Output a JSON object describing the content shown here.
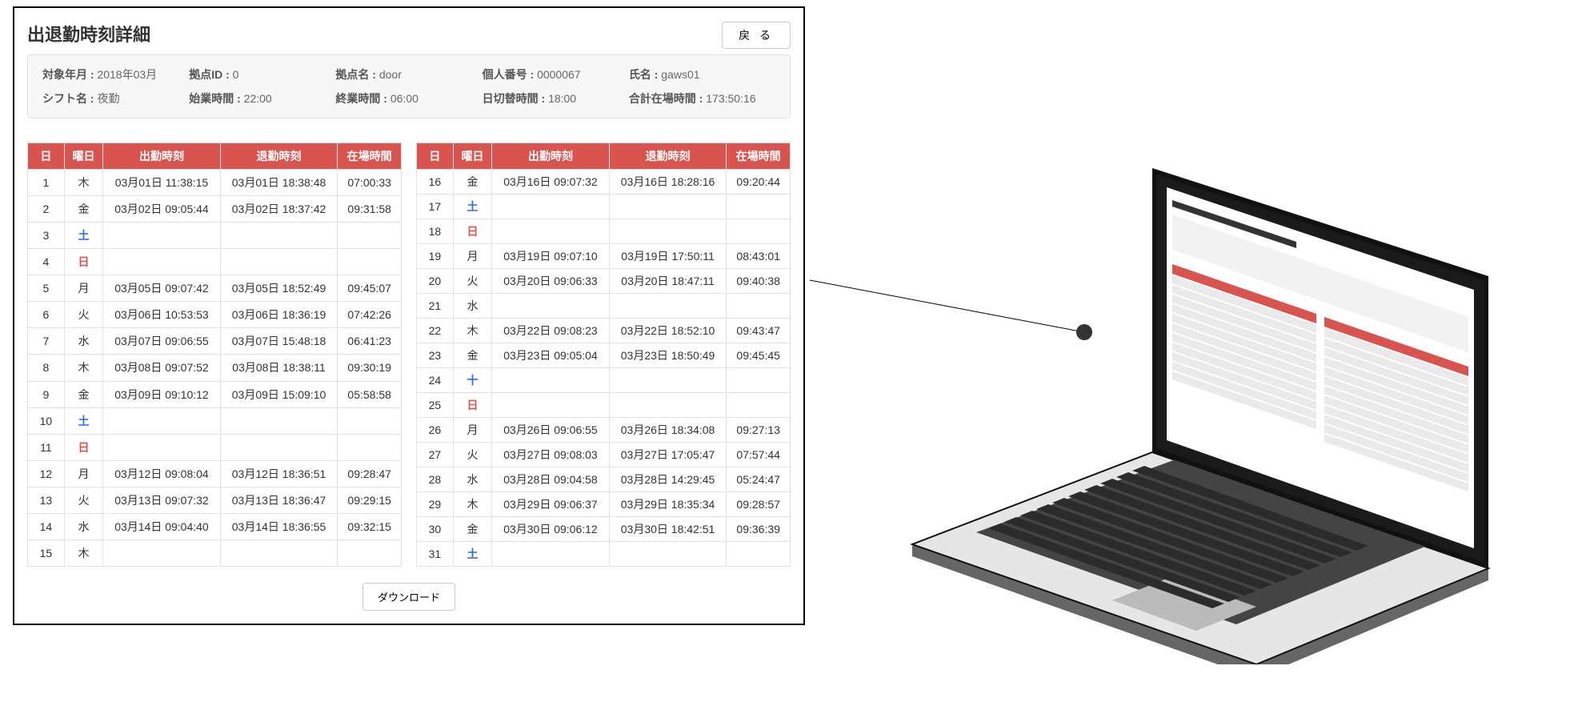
{
  "title": "出退勤時刻詳細",
  "buttons": {
    "back": "戻 る",
    "download": "ダウンロード"
  },
  "meta": {
    "row1": [
      {
        "label": "対象年月 :",
        "value": "2018年03月"
      },
      {
        "label": "拠点ID :",
        "value": "0"
      },
      {
        "label": "拠点名 :",
        "value": "door"
      },
      {
        "label": "個人番号 :",
        "value": "0000067"
      },
      {
        "label": "氏名 :",
        "value": "gaws01"
      }
    ],
    "row2": [
      {
        "label": "シフト名 :",
        "value": "夜勤"
      },
      {
        "label": "始業時間 :",
        "value": "22:00"
      },
      {
        "label": "終業時間 :",
        "value": "06:00"
      },
      {
        "label": "日切替時間 :",
        "value": "18:00"
      },
      {
        "label": "合計在場時間 :",
        "value": "173:50:16"
      }
    ]
  },
  "columns": {
    "day": "日",
    "dow": "曜日",
    "in": "出勤時刻",
    "out": "退勤時刻",
    "dur": "在場時間"
  },
  "rows": [
    {
      "d": "1",
      "w": "木",
      "wc": "",
      "in": "03月01日 11:38:15",
      "out": "03月01日 18:38:48",
      "dur": "07:00:33"
    },
    {
      "d": "2",
      "w": "金",
      "wc": "",
      "in": "03月02日 09:05:44",
      "out": "03月02日 18:37:42",
      "dur": "09:31:58"
    },
    {
      "d": "3",
      "w": "土",
      "wc": "sat",
      "in": "",
      "out": "",
      "dur": ""
    },
    {
      "d": "4",
      "w": "日",
      "wc": "sun",
      "in": "",
      "out": "",
      "dur": ""
    },
    {
      "d": "5",
      "w": "月",
      "wc": "",
      "in": "03月05日 09:07:42",
      "out": "03月05日 18:52:49",
      "dur": "09:45:07"
    },
    {
      "d": "6",
      "w": "火",
      "wc": "",
      "in": "03月06日 10:53:53",
      "out": "03月06日 18:36:19",
      "dur": "07:42:26"
    },
    {
      "d": "7",
      "w": "水",
      "wc": "",
      "in": "03月07日 09:06:55",
      "out": "03月07日 15:48:18",
      "dur": "06:41:23"
    },
    {
      "d": "8",
      "w": "木",
      "wc": "",
      "in": "03月08日 09:07:52",
      "out": "03月08日 18:38:11",
      "dur": "09:30:19"
    },
    {
      "d": "9",
      "w": "金",
      "wc": "",
      "in": "03月09日 09:10:12",
      "out": "03月09日 15:09:10",
      "dur": "05:58:58"
    },
    {
      "d": "10",
      "w": "土",
      "wc": "sat",
      "in": "",
      "out": "",
      "dur": ""
    },
    {
      "d": "11",
      "w": "日",
      "wc": "sun",
      "in": "",
      "out": "",
      "dur": ""
    },
    {
      "d": "12",
      "w": "月",
      "wc": "",
      "in": "03月12日 09:08:04",
      "out": "03月12日 18:36:51",
      "dur": "09:28:47"
    },
    {
      "d": "13",
      "w": "火",
      "wc": "",
      "in": "03月13日 09:07:32",
      "out": "03月13日 18:36:47",
      "dur": "09:29:15"
    },
    {
      "d": "14",
      "w": "水",
      "wc": "",
      "in": "03月14日 09:04:40",
      "out": "03月14日 18:36:55",
      "dur": "09:32:15"
    },
    {
      "d": "15",
      "w": "木",
      "wc": "",
      "in": "",
      "out": "",
      "dur": ""
    },
    {
      "d": "16",
      "w": "金",
      "wc": "",
      "in": "03月16日 09:07:32",
      "out": "03月16日 18:28:16",
      "dur": "09:20:44"
    },
    {
      "d": "17",
      "w": "土",
      "wc": "sat",
      "in": "",
      "out": "",
      "dur": ""
    },
    {
      "d": "18",
      "w": "日",
      "wc": "sun",
      "in": "",
      "out": "",
      "dur": ""
    },
    {
      "d": "19",
      "w": "月",
      "wc": "",
      "in": "03月19日 09:07:10",
      "out": "03月19日 17:50:11",
      "dur": "08:43:01"
    },
    {
      "d": "20",
      "w": "火",
      "wc": "",
      "in": "03月20日 09:06:33",
      "out": "03月20日 18:47:11",
      "dur": "09:40:38"
    },
    {
      "d": "21",
      "w": "水",
      "wc": "",
      "in": "",
      "out": "",
      "dur": ""
    },
    {
      "d": "22",
      "w": "木",
      "wc": "",
      "in": "03月22日 09:08:23",
      "out": "03月22日 18:52:10",
      "dur": "09:43:47"
    },
    {
      "d": "23",
      "w": "金",
      "wc": "",
      "in": "03月23日 09:05:04",
      "out": "03月23日 18:50:49",
      "dur": "09:45:45"
    },
    {
      "d": "24",
      "w": "十",
      "wc": "sat",
      "in": "",
      "out": "",
      "dur": ""
    },
    {
      "d": "25",
      "w": "日",
      "wc": "sun",
      "in": "",
      "out": "",
      "dur": ""
    },
    {
      "d": "26",
      "w": "月",
      "wc": "",
      "in": "03月26日 09:06:55",
      "out": "03月26日 18:34:08",
      "dur": "09:27:13"
    },
    {
      "d": "27",
      "w": "火",
      "wc": "",
      "in": "03月27日 09:08:03",
      "out": "03月27日 17:05:47",
      "dur": "07:57:44"
    },
    {
      "d": "28",
      "w": "水",
      "wc": "",
      "in": "03月28日 09:04:58",
      "out": "03月28日 14:29:45",
      "dur": "05:24:47"
    },
    {
      "d": "29",
      "w": "木",
      "wc": "",
      "in": "03月29日 09:06:37",
      "out": "03月29日 18:35:34",
      "dur": "09:28:57"
    },
    {
      "d": "30",
      "w": "金",
      "wc": "",
      "in": "03月30日 09:06:12",
      "out": "03月30日 18:42:51",
      "dur": "09:36:39"
    },
    {
      "d": "31",
      "w": "土",
      "wc": "sat",
      "in": "",
      "out": "",
      "dur": ""
    }
  ]
}
